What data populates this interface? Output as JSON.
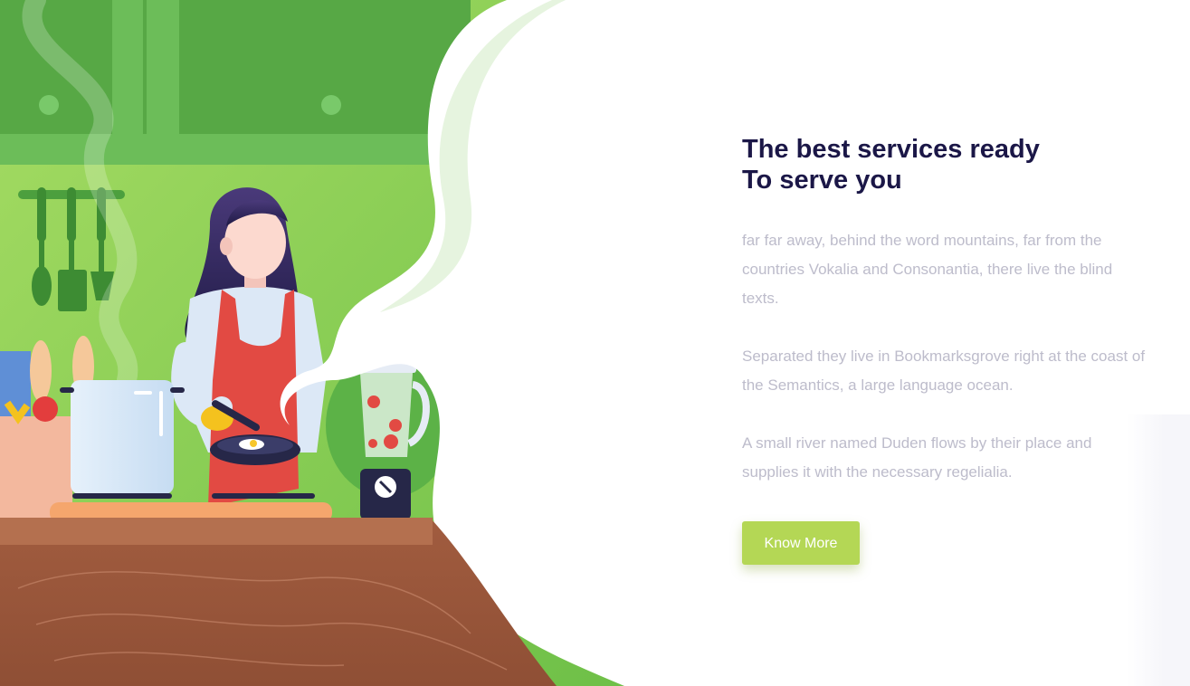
{
  "section": {
    "heading_line1": "The best services ready",
    "heading_line2": "To serve you",
    "paragraph1": "far far away, behind the word mountains, far from the countries Vokalia and Consonantia, there live the blind texts.",
    "paragraph2": "Separated they live in Bookmarksgrove right at the coast of the Semantics, a large language ocean.",
    "paragraph3": "A small river named Duden flows by their place and supplies it with the necessary regelialia.",
    "button_label": "Know More"
  },
  "illustration": {
    "subject": "woman cooking in kitchen",
    "icons": [
      "cabinet",
      "hanging-utensils",
      "grocery-bag",
      "cooking-pot",
      "frying-pan",
      "blender",
      "stove",
      "wooden-counter"
    ]
  },
  "colors": {
    "heading": "#1b1747",
    "body_text": "#bdbccb",
    "button_bg": "#b4d755",
    "button_text": "#ffffff",
    "accent_green": "#7cc24f",
    "counter_wood": "#9e5b3d"
  }
}
